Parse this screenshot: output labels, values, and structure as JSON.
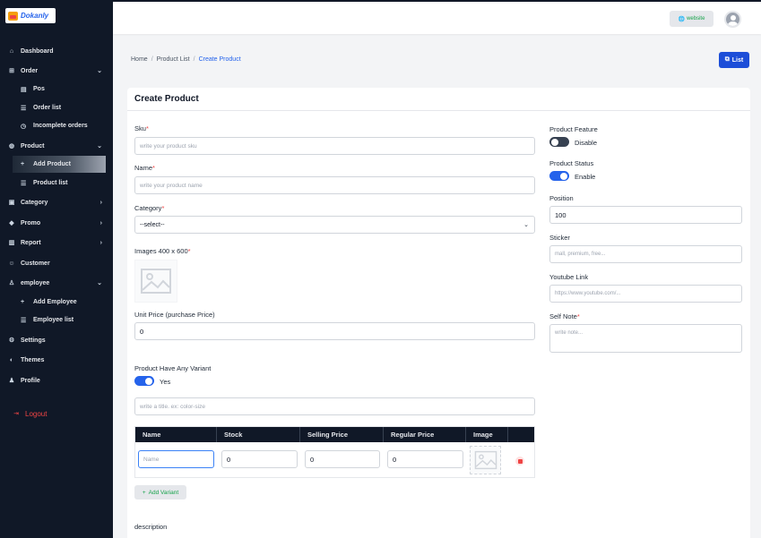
{
  "app": {
    "logo_text": "Dokanly"
  },
  "sidebar": {
    "items": [
      {
        "label": "Dashboard",
        "icon": "dashboard-icon"
      },
      {
        "label": "Order",
        "icon": "cart-icon"
      },
      {
        "label": "Pos",
        "icon": "pos-icon"
      },
      {
        "label": "Order list",
        "icon": "list-icon"
      },
      {
        "label": "Incomplete orders",
        "icon": "clock-icon"
      },
      {
        "label": "Product",
        "icon": "box-icon"
      },
      {
        "label": "Add Product",
        "icon": "plus-icon"
      },
      {
        "label": "Product list",
        "icon": "list-icon"
      },
      {
        "label": "Category",
        "icon": "category-icon"
      },
      {
        "label": "Promo",
        "icon": "tag-icon"
      },
      {
        "label": "Report",
        "icon": "report-icon"
      },
      {
        "label": "Customer",
        "icon": "users-icon"
      },
      {
        "label": "employee",
        "icon": "user-icon"
      },
      {
        "label": "Add Employee",
        "icon": "plus-icon"
      },
      {
        "label": "Employee list",
        "icon": "list-icon"
      },
      {
        "label": "Settings",
        "icon": "gear-icon"
      },
      {
        "label": "Themes",
        "icon": "palette-icon"
      },
      {
        "label": "Profile",
        "icon": "profile-icon"
      }
    ],
    "logout_label": "Logout"
  },
  "topbar": {
    "website_label": "website"
  },
  "breadcrumb": {
    "home": "Home",
    "list": "Product List",
    "current": "Create Product"
  },
  "list_button": "List",
  "form": {
    "title": "Create Product",
    "sku_label": "Sku",
    "sku_placeholder": "write your product sku",
    "name_label": "Name",
    "name_placeholder": "write your product name",
    "category_label": "Category",
    "category_value": "--select--",
    "images_label": "Images 400 x 600",
    "unit_price_label": "Unit Price (purchase Price)",
    "unit_price_value": "0",
    "variant_label": "Product Have Any Variant",
    "variant_toggle_label": "Yes",
    "variant_title_placeholder": "write a title. ex: color-size",
    "variant_table": {
      "headers": [
        "Name",
        "Stock",
        "Selling Price",
        "Regular Price",
        "Image"
      ],
      "row": {
        "name_placeholder": "Name",
        "stock": "0",
        "selling_price": "0",
        "regular_price": "0"
      }
    },
    "add_variant_label": "Add Variant",
    "description_label": "description",
    "feature_label": "Product Feature",
    "feature_toggle_label": "Disable",
    "status_label": "Product Status",
    "status_toggle_label": "Enable",
    "position_label": "Position",
    "position_value": "100",
    "sticker_label": "Sticker",
    "sticker_placeholder": "mall, premium, free...",
    "youtube_label": "Youtube Link",
    "youtube_placeholder": "https://www.youtube.com/...",
    "self_note_label": "Self Note",
    "self_note_placeholder": "write note..."
  },
  "colors": {
    "sidebar_bg": "#101827",
    "primary": "#1d4ed8",
    "accent_green": "#16a34a",
    "danger": "#ef4444"
  }
}
